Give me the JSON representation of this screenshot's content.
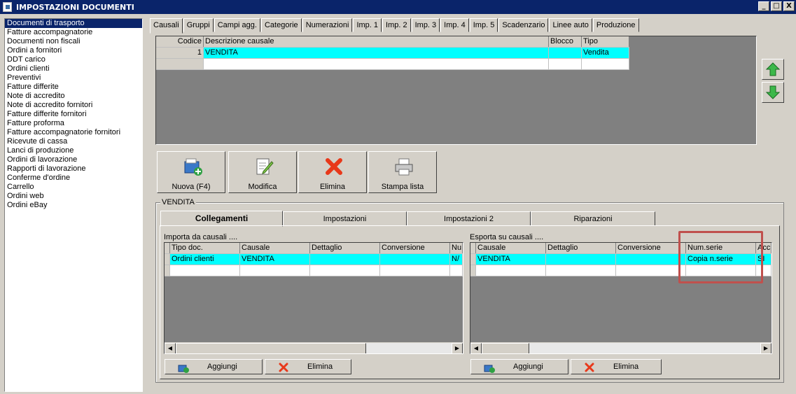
{
  "window": {
    "title": "IMPOSTAZIONI DOCUMENTI",
    "min_label": "_",
    "max_label": "□",
    "close_label": "X"
  },
  "sidebar": {
    "items": [
      "Documenti di trasporto",
      "Fatture accompagnatorie",
      "Documenti non fiscali",
      "Ordini a fornitori",
      "DDT carico",
      "Ordini clienti",
      "Preventivi",
      "Fatture differite",
      "Note di accredito",
      "Note di accredito fornitori",
      "Fatture differite fornitori",
      "Fatture proforma",
      "Fatture accompagnatorie fornitori",
      "Ricevute di cassa",
      "Lanci di produzione",
      "Ordini di lavorazione",
      "Rapporti di lavorazione",
      "Conferme d'ordine",
      "Carrello",
      "Ordini web",
      "Ordini eBay"
    ],
    "selected_index": 0
  },
  "tabs": [
    "Causali",
    "Gruppi",
    "Campi agg.",
    "Categorie",
    "Numerazioni",
    "Imp. 1",
    "Imp. 2",
    "Imp. 3",
    "Imp. 4",
    "Imp. 5",
    "Scadenzario",
    "Linee auto",
    "Produzione"
  ],
  "active_tab": 0,
  "causali_grid": {
    "headers": {
      "codice": "Codice",
      "descrizione": "Descrizione causale",
      "blocco": "Blocco",
      "tipo": "Tipo"
    },
    "rows": [
      {
        "codice": "1",
        "descrizione": "VENDITA",
        "blocco": "",
        "tipo": "Vendita"
      }
    ]
  },
  "toolbar": {
    "nuova": "Nuova (F4)",
    "modifica": "Modifica",
    "elimina": "Elimina",
    "stampa": "Stampa lista"
  },
  "group": {
    "title": "VENDITA"
  },
  "subtabs": [
    "Collegamenti",
    "Impostazioni",
    "Impostazioni 2",
    "Riparazioni"
  ],
  "importa": {
    "label": "Importa da causali ....",
    "headers": {
      "tipo": "Tipo doc.",
      "causale": "Causale",
      "dettaglio": "Dettaglio",
      "conversione": "Conversione",
      "nu": "Nu"
    },
    "row": {
      "tipo": "Ordini clienti",
      "causale": "VENDITA",
      "dettaglio": "",
      "conversione": "",
      "nu": "N/"
    }
  },
  "esporta": {
    "label": "Esporta su causali ....",
    "headers": {
      "causale": "Causale",
      "dettaglio": "Dettaglio",
      "conversione": "Conversione",
      "numserie": "Num.serie",
      "acc": "Acc"
    },
    "row": {
      "causale": "VENDITA",
      "dettaglio": "",
      "conversione": "",
      "numserie": "Copia n.serie",
      "acc": "SI"
    }
  },
  "buttons": {
    "aggiungi": "Aggiungi",
    "elimina": "Elimina"
  },
  "colors": {
    "selection": "#00ffff",
    "titlebar": "#0a246a",
    "highlight": "#c0504d"
  }
}
